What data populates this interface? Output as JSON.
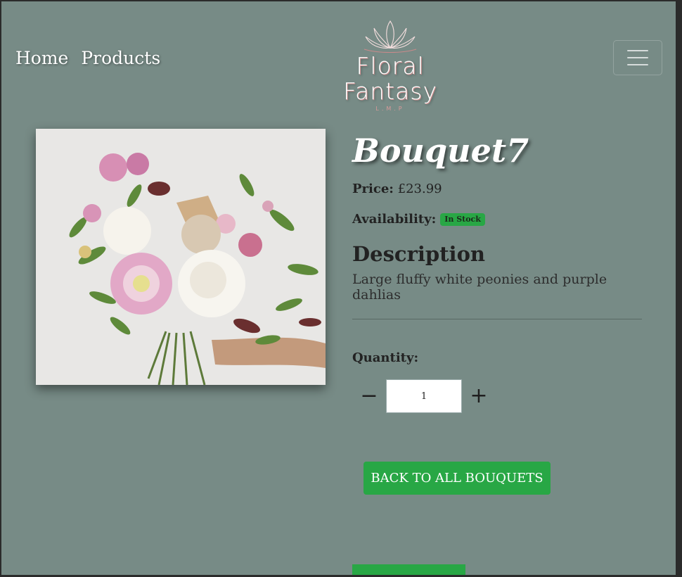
{
  "nav": {
    "links": [
      "Home",
      "Products"
    ],
    "brand_name": "Floral Fantasy",
    "brand_sub": "L.M.P"
  },
  "product": {
    "title": "Bouquet7",
    "price_label": "Price:",
    "price_value": "£23.99",
    "availability_label": "Availability:",
    "availability_badge": "In Stock",
    "description_heading": "Description",
    "description": "Large fluffy white peonies and purple dahlias",
    "quantity_label": "Quantity:",
    "quantity_value": "1",
    "decrement_symbol": "−",
    "increment_symbol": "+"
  },
  "actions": {
    "back_label": "BACK TO ALL BOUQUETS"
  },
  "colors": {
    "background": "#778b86",
    "accent": "#28a745"
  }
}
